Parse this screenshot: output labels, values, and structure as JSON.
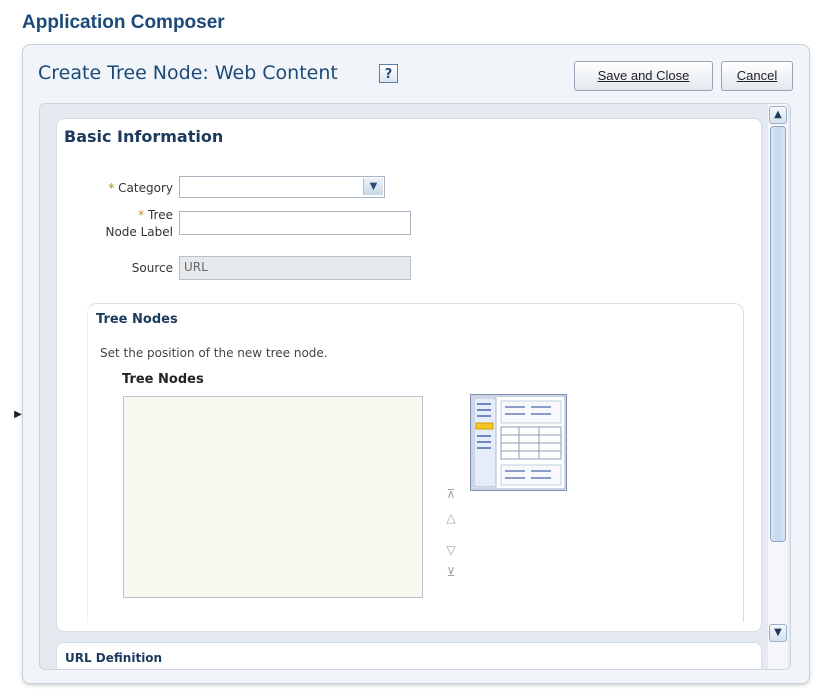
{
  "app_title": "Application Composer",
  "dialog": {
    "title": "Create Tree Node: Web Content",
    "help_label": "?",
    "save_and_close": "Save and Close",
    "cancel": "Cancel"
  },
  "basic_info": {
    "section_title": "Basic Information",
    "required_marker": "*",
    "category_label": "Category",
    "category_value": "",
    "tree_label_line1": "Tree",
    "tree_label_line2": "Node Label",
    "tree_node_label_value": "",
    "source_label": "Source",
    "source_value": "URL"
  },
  "tree_nodes": {
    "section_title": "Tree Nodes",
    "hint": "Set the position of the new tree node.",
    "list_title": "Tree Nodes",
    "list_items": [],
    "move_controls": {
      "top_glyph": "⊼",
      "up_glyph": "△",
      "down_glyph": "▽",
      "bottom_glyph": "⊻"
    }
  },
  "next_section": {
    "title_partial": "URL Definition"
  },
  "icons": {
    "dropdown": "chevron-down-icon",
    "scroll_up": "chevron-up-icon",
    "scroll_down": "chevron-down-icon",
    "side_toggle": "triangle-right-icon"
  },
  "colors": {
    "title_blue": "#1b4a79",
    "required_marker": "#c48a00"
  }
}
